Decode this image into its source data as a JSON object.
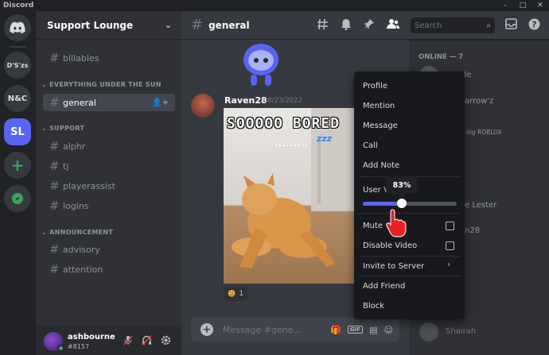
{
  "window": {
    "title": "Discord",
    "controls": [
      "–",
      "□",
      "✕"
    ]
  },
  "servers": [
    {
      "label": "",
      "icon": "discord-logo-icon"
    },
    {
      "label": "D'S'zs"
    },
    {
      "label": "N&C"
    },
    {
      "label": "SL",
      "active": true
    },
    {
      "label": "+",
      "icon": "add-server-icon"
    },
    {
      "label": "",
      "icon": "compass-icon"
    }
  ],
  "guild": {
    "name": "Support Lounge"
  },
  "channels": {
    "top": [
      {
        "name": "billables"
      }
    ],
    "categories": [
      {
        "title": "EVERYTHING UNDER THE SUN",
        "channels": [
          "general"
        ]
      },
      {
        "title": "SUPPORT",
        "channels": [
          "alphr",
          "tj",
          "playerassist",
          "logins"
        ]
      },
      {
        "title": "ANNOUNCEMENT",
        "channels": [
          "advisory",
          "attention"
        ]
      }
    ],
    "selected": "general"
  },
  "user": {
    "name": "ashbourne",
    "tag": "#8157"
  },
  "chat_header": {
    "channel": "general",
    "search_placeholder": "Search"
  },
  "message": {
    "author": "Raven28",
    "date": "08/23/2022",
    "gif_caption": "SOOOOO BORED",
    "gif_dots": ".........",
    "gif_zzz": "zzz",
    "reaction_count": "1"
  },
  "composer": {
    "placeholder": "Message #gene..."
  },
  "members": {
    "online_label": "ONLINE — 7",
    "fragments": [
      "de",
      "arrow'z",
      "ing ROBLOX",
      "e Lester",
      "n28",
      "Shairah"
    ]
  },
  "context_menu": {
    "items": [
      "Profile",
      "Mention",
      "Message",
      "Call",
      "Add Note",
      "User V",
      "Mute",
      "Disable Video",
      "Invite to Server",
      "Add Friend",
      "Block"
    ],
    "volume_percent": 83,
    "volume_label": "83%"
  },
  "colors": {
    "accent": "#5865f2",
    "online": "#3ba55d",
    "background": "#36393f"
  }
}
